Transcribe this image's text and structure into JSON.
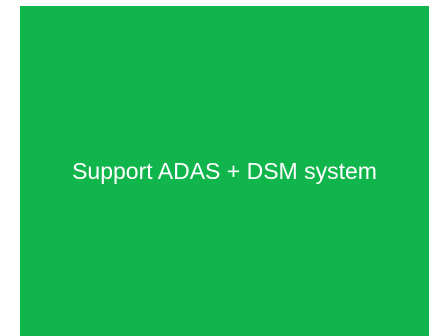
{
  "tile": {
    "text": "Support ADAS + DSM system",
    "background_color": "#10b54c",
    "text_color": "#ffffff"
  }
}
